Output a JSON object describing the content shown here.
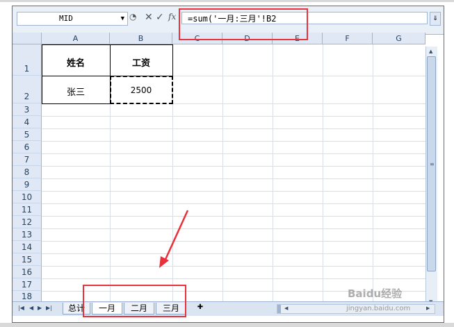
{
  "formula_bar": {
    "name_box": "MID",
    "input": "=sum('一月:三月'!B2",
    "fx_label": "fx"
  },
  "columns": [
    "A",
    "B",
    "C",
    "D",
    "E",
    "F",
    "G"
  ],
  "rows": [
    "1",
    "2",
    "3",
    "4",
    "5",
    "6",
    "7",
    "8",
    "9",
    "10",
    "11",
    "12",
    "13",
    "14",
    "15",
    "16",
    "17",
    "18"
  ],
  "cells": {
    "A1": "姓名",
    "B1": "工资",
    "A2": "张三",
    "B2": "2500"
  },
  "sheet_tabs": [
    "总计",
    "一月",
    "二月",
    "三月"
  ],
  "active_tab": "一月",
  "annotations": {
    "highlight_color": "#e8313a",
    "arrow_color": "#e8313a"
  },
  "watermark": {
    "line1": "Baidu经验",
    "line2": "jingyan.baidu.com"
  }
}
